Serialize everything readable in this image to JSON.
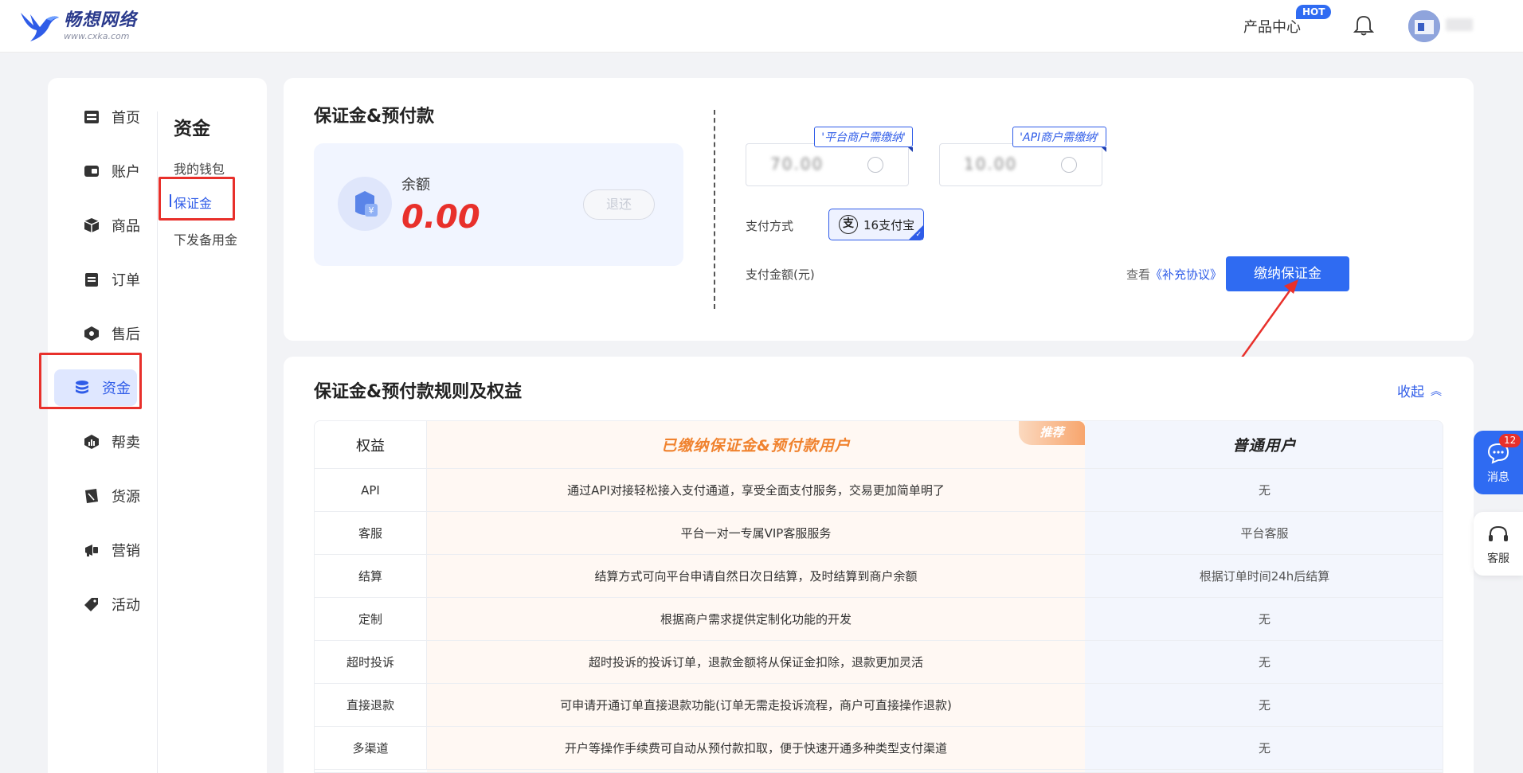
{
  "header": {
    "logo_name": "畅想网络",
    "logo_url": "www.cxka.com",
    "product_center": "产品中心",
    "hot_badge": "HOT"
  },
  "sidebar": {
    "items": [
      {
        "label": "首页",
        "icon": "shop-icon"
      },
      {
        "label": "账户",
        "icon": "wallet-icon"
      },
      {
        "label": "商品",
        "icon": "box-icon"
      },
      {
        "label": "订单",
        "icon": "clipboard-icon"
      },
      {
        "label": "售后",
        "icon": "shield-icon"
      },
      {
        "label": "资金",
        "icon": "coins-icon",
        "active": true
      },
      {
        "label": "帮卖",
        "icon": "chart-icon"
      },
      {
        "label": "货源",
        "icon": "goods-icon"
      },
      {
        "label": "营销",
        "icon": "megaphone-icon"
      },
      {
        "label": "活动",
        "icon": "tag-icon"
      }
    ]
  },
  "subnav": {
    "title": "资金",
    "items": [
      {
        "label": "我的钱包"
      },
      {
        "label": "保证金",
        "active": true
      },
      {
        "label": "下发备用金"
      }
    ]
  },
  "deposit_card": {
    "title": "保证金&预付款",
    "balance_label": "余额",
    "balance_amount": "0.00",
    "refund_button": "退还",
    "options": [
      {
        "tag": "'平台商户需缴纳'",
        "value": "70.00"
      },
      {
        "tag": "'API商户需缴纳'",
        "value": "10.00"
      }
    ],
    "pay_method_label": "支付方式",
    "pay_method": "16支付宝",
    "pay_amount_label": "支付金额(元)",
    "view_prefix": "查看",
    "agreement_link": "《补充协议》",
    "pay_button": "缴纳保证金"
  },
  "rules_card": {
    "title": "保证金&预付款规则及权益",
    "collapse_label": "收起",
    "headers": {
      "benefit": "权益",
      "paid_users": "已缴纳保证金&预付款用户",
      "normal_users": "普通用户",
      "recommend_tag": "推荐"
    },
    "rows": [
      {
        "name": "API",
        "paid": "通过API对接轻松接入支付通道，享受全面支付服务，交易更加简单明了",
        "normal": "无"
      },
      {
        "name": "客服",
        "paid": "平台一对一专属VIP客服服务",
        "normal": "平台客服"
      },
      {
        "name": "结算",
        "paid": "结算方式可向平台申请自然日次日结算，及时结算到商户余额",
        "normal": "根据订单时间24h后结算"
      },
      {
        "name": "定制",
        "paid": "根据商户需求提供定制化功能的开发",
        "normal": "无"
      },
      {
        "name": "超时投诉",
        "paid": "超时投诉的投诉订单，退款金额将从保证金扣除，退款更加灵活",
        "normal": "无"
      },
      {
        "name": "直接退款",
        "paid": "可申请开通订单直接退款功能(订单无需走投诉流程，商户可直接操作退款)",
        "normal": "无"
      },
      {
        "name": "多渠道",
        "paid": "开户等操作手续费可自动从预付款扣取，便于快速开通多种类型支付渠道",
        "normal": "无"
      }
    ]
  },
  "floating": {
    "message_label": "消息",
    "message_count": "12",
    "service_label": "客服"
  },
  "colors": {
    "accent": "#2f6bf2",
    "danger": "#e8302b",
    "highlight": "#f0822e"
  }
}
